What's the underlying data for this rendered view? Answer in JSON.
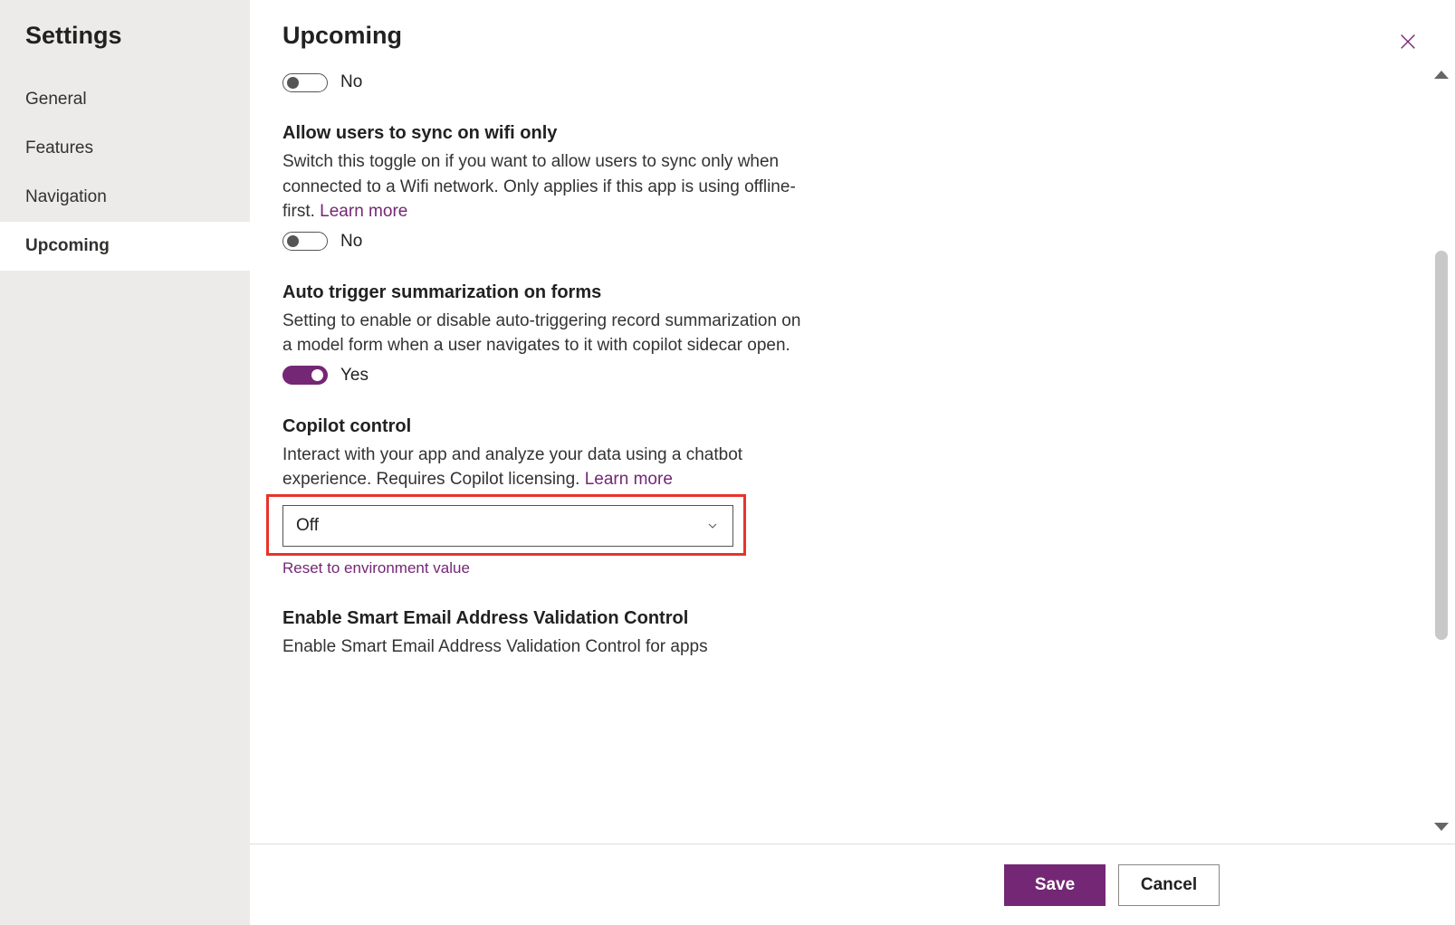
{
  "sidebar": {
    "title": "Settings",
    "items": [
      {
        "label": "General"
      },
      {
        "label": "Features"
      },
      {
        "label": "Navigation"
      },
      {
        "label": "Upcoming"
      }
    ],
    "active_index": 3
  },
  "page": {
    "title": "Upcoming"
  },
  "settings": {
    "orphan_toggle": {
      "state": "No"
    },
    "wifi_sync": {
      "title": "Allow users to sync on wifi only",
      "desc": "Switch this toggle on if you want to allow users to sync only when connected to a Wifi network. Only applies if this app is using offline-first. ",
      "learn_more": "Learn more",
      "state": "No"
    },
    "auto_summarize": {
      "title": "Auto trigger summarization on forms",
      "desc": "Setting to enable or disable auto-triggering record summarization on a model form when a user navigates to it with copilot sidecar open.",
      "state": "Yes"
    },
    "copilot": {
      "title": "Copilot control",
      "desc": "Interact with your app and analyze your data using a chatbot experience. Requires Copilot licensing. ",
      "learn_more": "Learn more",
      "selected": "Off",
      "reset_link": "Reset to environment value"
    },
    "smart_email": {
      "title": "Enable Smart Email Address Validation Control",
      "desc": "Enable Smart Email Address Validation Control for apps"
    }
  },
  "footer": {
    "save": "Save",
    "cancel": "Cancel"
  }
}
